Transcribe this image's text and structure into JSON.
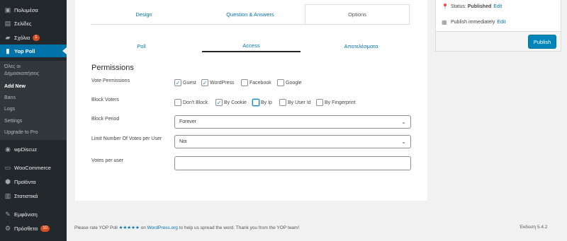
{
  "sidebar": {
    "items": [
      {
        "label": "Πολυμέσα",
        "icon": "media-icon"
      },
      {
        "label": "Σελίδες",
        "icon": "pages-icon"
      },
      {
        "label": "Σχόλια",
        "icon": "comments-icon",
        "badge": "1"
      },
      {
        "label": "Yop Poll",
        "icon": "poll-icon"
      },
      {
        "label": "wpDiscuz",
        "icon": "discuss-icon"
      },
      {
        "label": "WooCommerce",
        "icon": "woo-icon"
      },
      {
        "label": "Προϊόντα",
        "icon": "products-icon"
      },
      {
        "label": "Στατιστικά",
        "icon": "stats-icon"
      },
      {
        "label": "Εμφάνιση",
        "icon": "appearance-icon"
      },
      {
        "label": "Πρόσθετα",
        "icon": "plugins-icon",
        "badge": "10"
      }
    ],
    "submenu": [
      "Όλες οι",
      "Δημοσκοπήσεις",
      "Add New",
      "Bans",
      "Logs",
      "Settings",
      "Upgrade to Pro"
    ]
  },
  "tabs": {
    "design": "Design",
    "qa": "Question & Answers",
    "options": "Options"
  },
  "subtabs": {
    "poll": "Poll",
    "access": "Access",
    "results": "Αποτελέσματα"
  },
  "permissions": {
    "title": "Permissions",
    "vote_permissions_label": "Vote Permissions",
    "vote_permissions": [
      {
        "label": "Guest",
        "checked": true
      },
      {
        "label": "WordPress",
        "checked": true
      },
      {
        "label": "Facebook",
        "checked": false
      },
      {
        "label": "Google",
        "checked": false
      }
    ],
    "block_voters_label": "Block Voters",
    "block_voters": [
      {
        "label": "Don't Block",
        "checked": false
      },
      {
        "label": "By Cookie",
        "checked": true
      },
      {
        "label": "By Ip",
        "checked": false
      },
      {
        "label": "By User Id",
        "checked": false
      },
      {
        "label": "By Fingerprint",
        "checked": false
      }
    ],
    "block_period_label": "Block Period",
    "block_period_value": "Forever",
    "limit_label": "Limit Number Of Votes per User",
    "limit_value": "Ναι",
    "votes_per_user_label": "Votes per user",
    "votes_per_user_value": ""
  },
  "publish": {
    "status_label": "Status:",
    "status_value": "Published",
    "edit": "Edit",
    "publish_text": "Publish",
    "publish_when": "immediately",
    "button": "Publish"
  },
  "footer": {
    "pre": "Please rate YOP Poll",
    "stars": "★★★★★",
    "on": "on",
    "link": "WordPress.org",
    "post": "to help us spread the word. Thank you from the YOP team!",
    "version": "Έκδοση 5.4.2"
  },
  "colors": {
    "accent": "#0073aa",
    "sidebar": "#23282d",
    "badge": "#d54e21"
  }
}
